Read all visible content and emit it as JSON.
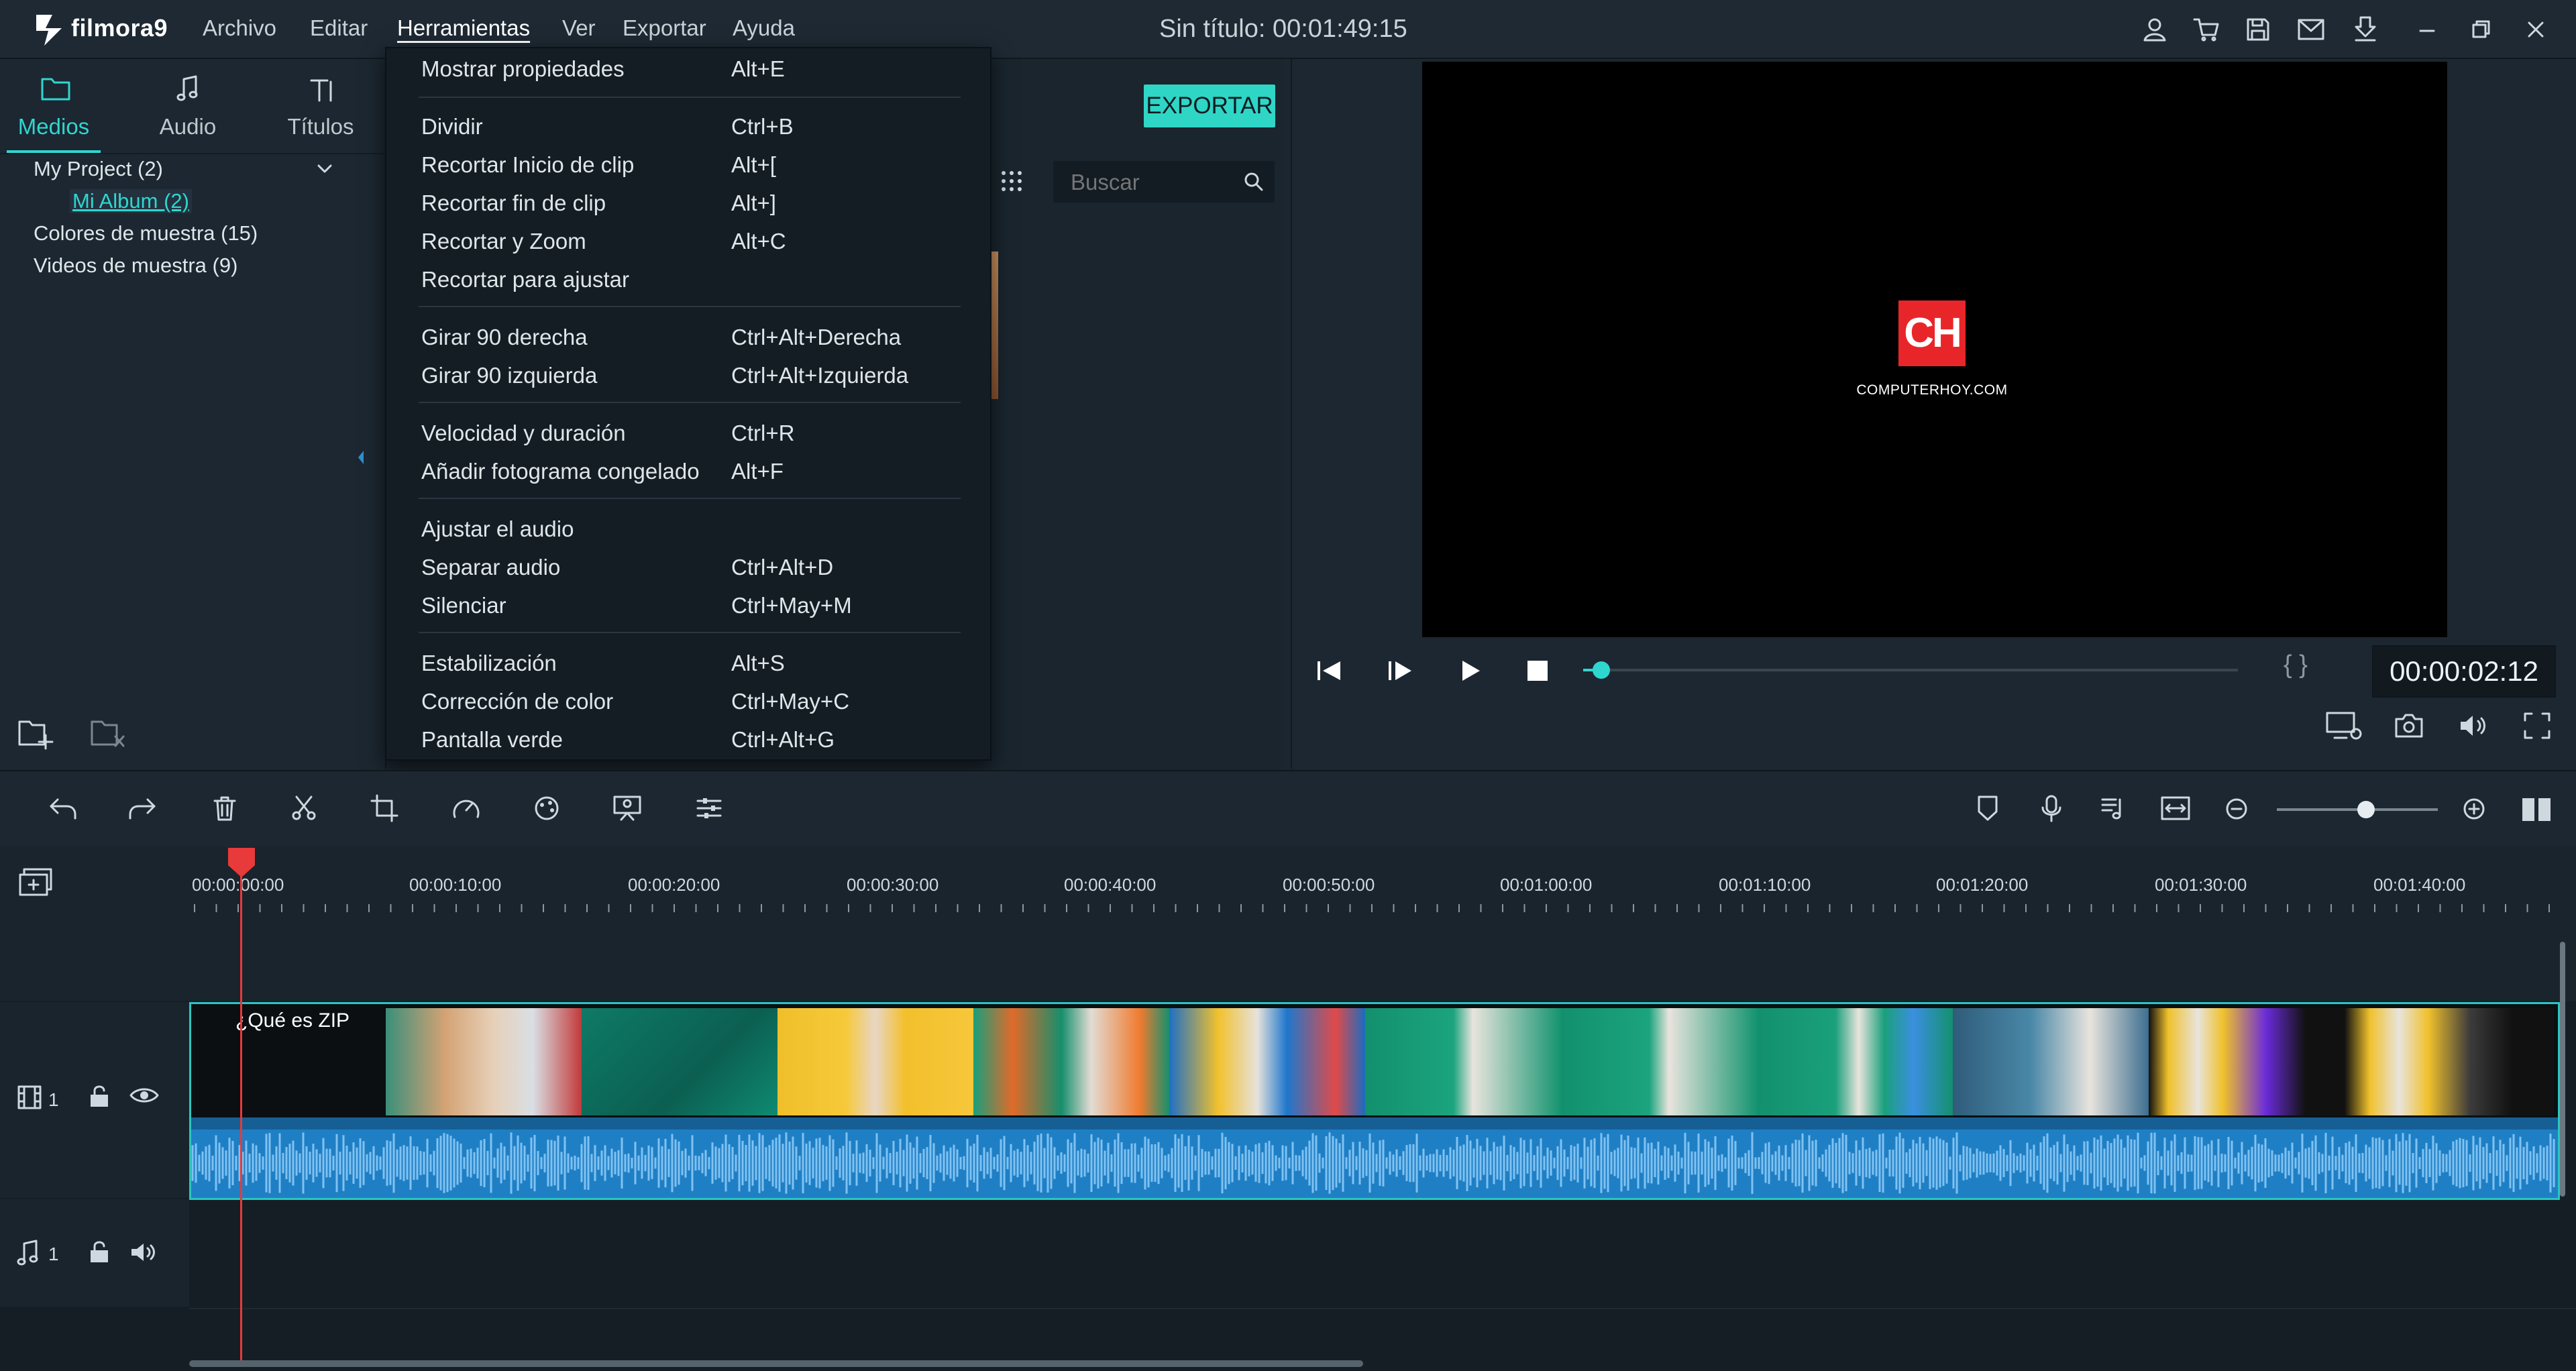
{
  "app": {
    "brand": "filmora9",
    "doc_title": "Sin título:  00:01:49:15",
    "menu": [
      "Archivo",
      "Editar",
      "Herramientas",
      "Ver",
      "Exportar",
      "Ayuda"
    ]
  },
  "library": {
    "tabs": [
      "Medios",
      "Audio",
      "Títulos"
    ],
    "tree": {
      "project": "My Project (2)",
      "album": "Mi Album (2)",
      "colors": "Colores de muestra (15)",
      "videos": "Videos de muestra (9)"
    }
  },
  "media": {
    "export_label": "EXPORTAR",
    "search_placeholder": "Buscar"
  },
  "tools_menu": {
    "items": [
      {
        "label": "Mostrar propiedades",
        "shortcut": "Alt+E"
      },
      {
        "label": "Dividir",
        "shortcut": "Ctrl+B"
      },
      {
        "label": "Recortar Inicio de clip",
        "shortcut": "Alt+["
      },
      {
        "label": "Recortar fin de clip",
        "shortcut": "Alt+]"
      },
      {
        "label": "Recortar y Zoom",
        "shortcut": "Alt+C"
      },
      {
        "label": "Recortar para ajustar",
        "shortcut": ""
      },
      {
        "label": "Girar 90 derecha",
        "shortcut": "Ctrl+Alt+Derecha"
      },
      {
        "label": "Girar 90 izquierda",
        "shortcut": "Ctrl+Alt+Izquierda"
      },
      {
        "label": "Velocidad y duración",
        "shortcut": "Ctrl+R"
      },
      {
        "label": "Añadir fotograma congelado",
        "shortcut": "Alt+F"
      },
      {
        "label": "Ajustar el audio",
        "shortcut": ""
      },
      {
        "label": "Separar audio",
        "shortcut": "Ctrl+Alt+D"
      },
      {
        "label": "Silenciar",
        "shortcut": "Ctrl+May+M"
      },
      {
        "label": "Estabilización",
        "shortcut": "Alt+S"
      },
      {
        "label": "Corrección de color",
        "shortcut": "Ctrl+May+C"
      },
      {
        "label": "Pantalla verde",
        "shortcut": "Ctrl+Alt+G"
      }
    ]
  },
  "player": {
    "logo_text": "CH",
    "logo_sub": "COMPUTERHOY.COM",
    "timecode": "00:00:02:12",
    "brackets": "{  }"
  },
  "timeline": {
    "ruler": [
      "00:00:00:00",
      "00:00:10:00",
      "00:00:20:00",
      "00:00:30:00",
      "00:00:40:00",
      "00:00:50:00",
      "00:01:00:00",
      "00:01:10:00",
      "00:01:20:00",
      "00:01:30:00",
      "00:01:40:00"
    ],
    "clip_title": "¿Qué es ZIP",
    "video_track_num": "1",
    "audio_track_num": "1"
  },
  "colors": {
    "accent": "#2fd6cf",
    "playhead": "#e83a3a",
    "audio_wave": "#1f7fc4",
    "logo_red": "#e8262a"
  }
}
